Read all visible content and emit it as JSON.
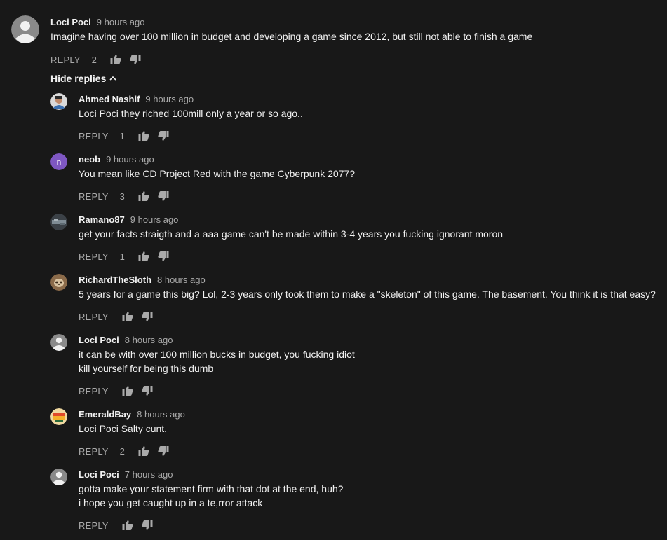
{
  "top_comment": {
    "author": "Loci Poci",
    "time": "9 hours ago",
    "text": "Imagine having over 100 million in budget and developing a game since 2012, but still not able to finish a game",
    "reply_label": "REPLY",
    "likes": "2",
    "avatar": "default-avatar-icon"
  },
  "hide_replies_label": "Hide replies",
  "replies": [
    {
      "author": "Ahmed Nashif",
      "time": "9 hours ago",
      "lines": [
        "Loci Poci they riched 100mill only a year or so ago.."
      ],
      "reply_label": "REPLY",
      "likes": "1",
      "avatar": "photo-avatar-icon"
    },
    {
      "author": "neob",
      "time": "9 hours ago",
      "lines": [
        "You mean like CD Project Red with the game Cyberpunk 2077?"
      ],
      "reply_label": "REPLY",
      "likes": "3",
      "avatar": "letter-avatar-icon",
      "avatar_letter": "n",
      "avatar_color": "#7e57c2"
    },
    {
      "author": "Ramano87",
      "time": "9 hours ago",
      "lines": [
        "get your facts straigth and a aaa game can't be made within 3-4 years you fucking ignorant moron"
      ],
      "reply_label": "REPLY",
      "likes": "1",
      "avatar": "photo-avatar-icon"
    },
    {
      "author": "RichardTheSloth",
      "time": "8 hours ago",
      "lines": [
        "5 years for a game this big? Lol, 2-3 years only took them to make a \"skeleton\" of this game. The basement. You think it is that easy?"
      ],
      "reply_label": "REPLY",
      "likes": "",
      "avatar": "sloth-avatar-icon"
    },
    {
      "author": "Loci Poci",
      "time": "8 hours ago",
      "lines": [
        "it can be with over 100 million bucks in budget, you fucking idiot",
        "kill yourself for being this dumb"
      ],
      "reply_label": "REPLY",
      "likes": "",
      "avatar": "default-avatar-icon"
    },
    {
      "author": "EmeraldBay",
      "time": "8 hours ago",
      "lines": [
        "Loci Poci Salty cunt."
      ],
      "reply_label": "REPLY",
      "likes": "2",
      "avatar": "photo-avatar-icon"
    },
    {
      "author": "Loci Poci",
      "time": "7 hours ago",
      "lines": [
        "gotta make your statement firm with that dot at the end, huh?",
        "i hope you get caught up in a te,rror attack"
      ],
      "reply_label": "REPLY",
      "likes": "",
      "avatar": "default-avatar-icon"
    }
  ],
  "colors": {
    "background": "#181818",
    "text": "#f1f1f1",
    "secondary": "#aaaaaa"
  }
}
